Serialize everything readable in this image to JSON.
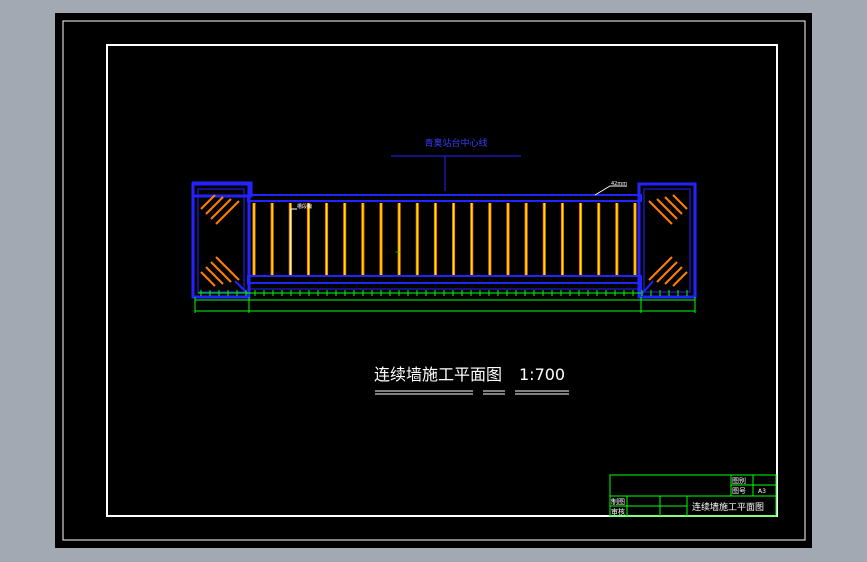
{
  "drawing": {
    "title": "连续墙施工平面图",
    "scale": "1:700",
    "center_line_label": "青奥站台中心线",
    "wall_label": "42mm",
    "annotation_label": "槽段编",
    "dim_mid_label": "mm"
  },
  "title_block": {
    "drawing_name": "连续墙施工平面图",
    "row1_label": "图别",
    "row2_label": "图号",
    "row2_value": "A3",
    "drawn_label": "制图",
    "review_label": "审核"
  },
  "colors": {
    "background": "#000000",
    "frame": "#ffffff",
    "outer_frame": "#ffffff",
    "wall": "#2323ff",
    "rebar": "#ff7f00",
    "rebar_core": "#ffff00",
    "dimension": "#00ff00",
    "text_blue": "#3a3aff",
    "title_block": "#00ff00",
    "title_text": "#ffffff"
  },
  "panel_count": 22
}
